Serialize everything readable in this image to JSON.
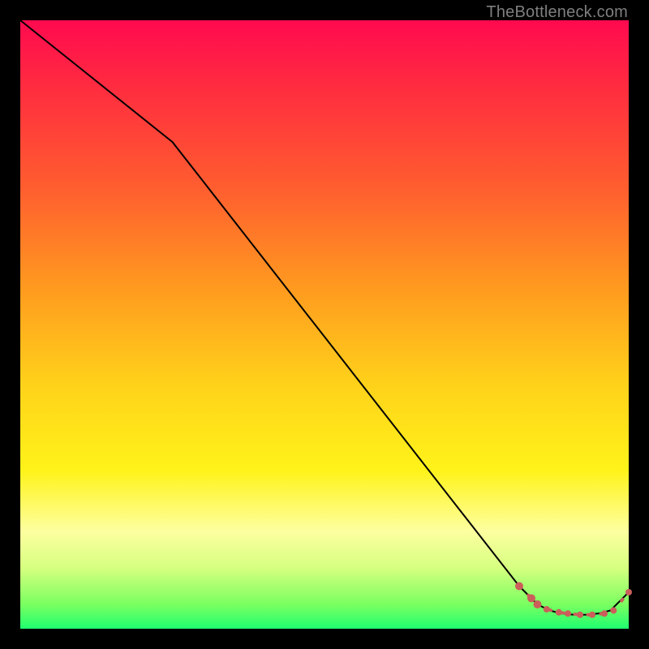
{
  "attribution": "TheBottleneck.com",
  "chart_data": {
    "type": "line",
    "title": "",
    "xlabel": "",
    "ylabel": "",
    "xlim": [
      0,
      100
    ],
    "ylim": [
      0,
      100
    ],
    "grid": false,
    "legend": false,
    "series": [
      {
        "name": "bottleneck-curve",
        "color": "#000000",
        "style": "solid",
        "x": [
          0,
          25,
          82,
          85,
          87,
          89,
          91,
          93,
          95,
          97,
          100
        ],
        "y": [
          100,
          80,
          7,
          4,
          3,
          2.5,
          2.3,
          2.3,
          2.5,
          3,
          6
        ]
      },
      {
        "name": "data-points",
        "color": "#cc5e5a",
        "style": "markers-dashed",
        "x": [
          82,
          84,
          85,
          86.5,
          88.5,
          90,
          92,
          94,
          96,
          97.5,
          100
        ],
        "y": [
          7,
          5,
          4,
          3.2,
          2.7,
          2.5,
          2.3,
          2.3,
          2.5,
          3,
          6
        ]
      }
    ]
  }
}
